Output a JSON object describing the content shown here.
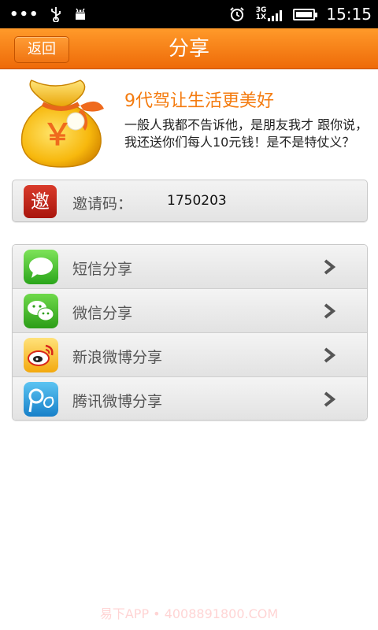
{
  "status_bar": {
    "dots": "•••",
    "network_top": "3G",
    "network_bottom": "1X",
    "time": "15:15"
  },
  "header": {
    "back_label": "返回",
    "title": "分享"
  },
  "promo": {
    "title": "9代驾让生活更美好",
    "description": "一般人我都不告诉他，是朋友我才 跟你说，我还送你们每人10元钱！是不是特仗义？",
    "bag_symbol": "￥"
  },
  "invite": {
    "icon_glyph": "邀",
    "label": "邀请码：",
    "code": "1750203"
  },
  "share_options": [
    {
      "label": "短信分享",
      "icon": "sms-icon"
    },
    {
      "label": "微信分享",
      "icon": "wechat-icon"
    },
    {
      "label": "新浪微博分享",
      "icon": "sina-weibo-icon"
    },
    {
      "label": "腾讯微博分享",
      "icon": "tencent-weibo-icon"
    }
  ],
  "watermark": "易下APP • 4008891800.COM",
  "colors": {
    "accent": "#f47b0f",
    "title_bar": "#ee6a08",
    "invite_red": "#c22617"
  }
}
